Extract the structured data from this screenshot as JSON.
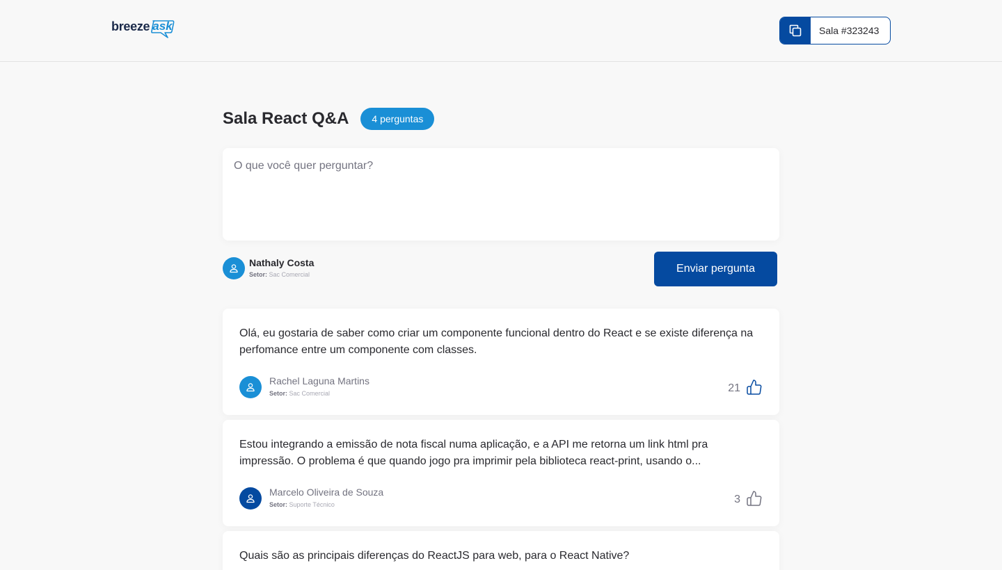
{
  "header": {
    "logo_main": "breeze",
    "logo_accent": "ask",
    "room_code": "Sala #323243"
  },
  "room": {
    "title": "Sala React Q&A",
    "question_count": "4 perguntas"
  },
  "form": {
    "placeholder": "O que você quer perguntar?",
    "user_name": "Nathaly Costa",
    "sector_label": "Setor:",
    "user_sector": "Sac Comercial",
    "submit_label": "Enviar pergunta"
  },
  "questions": [
    {
      "text": "Olá, eu gostaria de saber como criar um componente funcional dentro do React e se existe diferença na perfomance entre um componente com classes.",
      "author": "Rachel Laguna Martins",
      "sector_label": "Setor:",
      "sector": "Sac Comercial",
      "likes": "21"
    },
    {
      "text": "Estou integrando a emissão de nota fiscal numa aplicação, e a API me retorna um link html pra impressão. O problema é que quando jogo pra imprimir pela biblioteca react-print, usando o...",
      "author": "Marcelo Oliveira de Souza",
      "sector_label": "Setor:",
      "sector": "Suporte Técnico",
      "likes": "3"
    },
    {
      "text": "Quais são as principais diferenças do ReactJS para web, para o React Native?"
    }
  ],
  "colors": {
    "primary": "#054aa0",
    "accent": "#1a8fd6",
    "background": "#f8f8f8",
    "like_active": "#054aa0",
    "like_inactive": "#737380"
  },
  "icons": {
    "copy": "copy-icon",
    "user": "user-icon",
    "like": "thumbs-up-icon"
  }
}
